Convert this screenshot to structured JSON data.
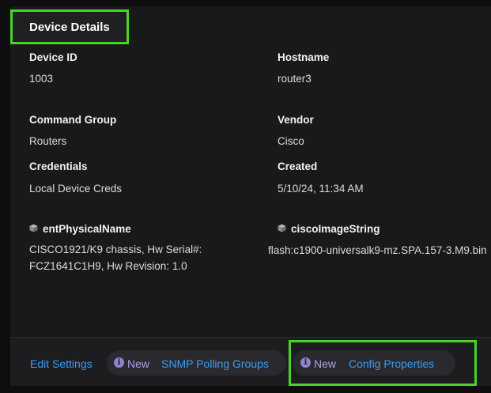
{
  "header": {
    "title": "Device Details"
  },
  "fields": {
    "device_id": {
      "label": "Device ID",
      "value": "1003"
    },
    "hostname": {
      "label": "Hostname",
      "value": "router3"
    },
    "command_group": {
      "label": "Command Group",
      "value": "Routers"
    },
    "vendor": {
      "label": "Vendor",
      "value": "Cisco"
    },
    "credentials": {
      "label": "Credentials",
      "value": "Local Device Creds"
    },
    "created": {
      "label": "Created",
      "value": "5/10/24, 11:34 AM"
    }
  },
  "properties": {
    "ent_physical_name": {
      "label": "entPhysicalName",
      "icon": "cube-icon",
      "value": "CISCO1921/K9 chassis, Hw Serial#: FCZ1641C1H9, Hw Revision: 1.0"
    },
    "cisco_image_string": {
      "label": "ciscoImageString",
      "icon": "cube-icon",
      "value": "flash:c1900-universalk9-mz.SPA.157-3.M9.bin"
    }
  },
  "footer": {
    "edit_settings": "Edit Settings",
    "snmp": {
      "badge": "New",
      "link": "SNMP Polling Groups",
      "icon": "info-icon"
    },
    "config": {
      "badge": "New",
      "link": "Config Properties",
      "icon": "info-icon"
    }
  },
  "colors": {
    "highlight": "#48d42a",
    "link": "#3b9cf5",
    "new_badge": "#a9a3e6",
    "panel_bg": "#19191b"
  }
}
